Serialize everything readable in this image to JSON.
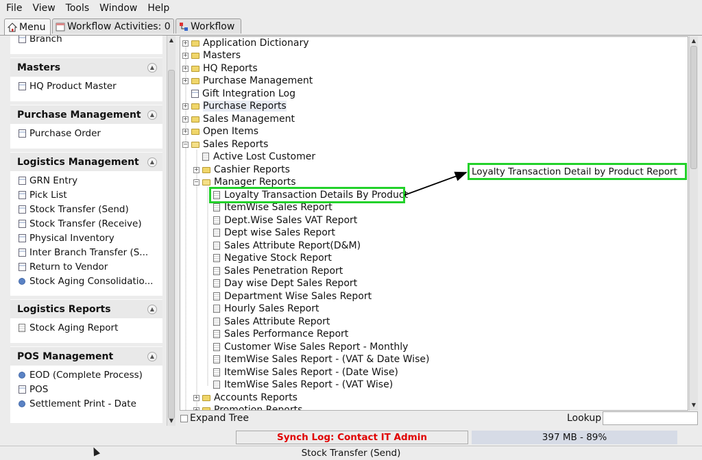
{
  "menubar": {
    "file": "File",
    "view": "View",
    "tools": "Tools",
    "window": "Window",
    "help": "Help"
  },
  "tabs": {
    "menu": "Menu",
    "workflow_activities": "Workflow Activities: 0",
    "workflow": "Workflow"
  },
  "left": {
    "partial_item": "Branch",
    "groups": [
      {
        "title": "Masters",
        "items": [
          "HQ Product Master"
        ]
      },
      {
        "title": "Purchase Management",
        "items": [
          "Purchase Order"
        ]
      },
      {
        "title": "Logistics Management",
        "items": [
          "GRN Entry",
          "Pick List",
          "Stock Transfer (Send)",
          "Stock Transfer (Receive)",
          "Physical Inventory",
          "Inter Branch Transfer (S...",
          "Return to Vendor",
          "Stock Aging Consolidatio..."
        ]
      },
      {
        "title": "Logistics Reports",
        "items": [
          "Stock Aging Report"
        ]
      },
      {
        "title": "POS Management",
        "items": [
          "EOD (Complete Process)",
          "POS",
          "Settlement Print - Date"
        ]
      }
    ]
  },
  "tree": {
    "top": [
      "Application Dictionary",
      "Masters",
      "HQ Reports",
      "Purchase Management",
      "Gift Integration Log",
      "Purchase Reports",
      "Sales Management",
      "Open Items",
      "Sales Reports"
    ],
    "sales_children": [
      "Active Lost Customer",
      "Cashier Reports",
      "Manager Reports"
    ],
    "manager_children": [
      "Loyalty Transaction Details By Product",
      "ItemWise Sales Report",
      "Dept.Wise Sales VAT Report",
      "Dept wise Sales Report",
      "Sales Attribute Report(D&M)",
      "Negative Stock Report",
      "Sales Penetration Report",
      "Day wise Dept Sales Report",
      "Department Wise Sales Report",
      "Hourly Sales Report",
      "Sales Attribute Report",
      "Sales Performance Report",
      "Customer Wise Sales Report - Monthly",
      "ItemWise Sales Report - (VAT & Date Wise)",
      "ItemWise Sales Report - (Date Wise)",
      "ItemWise Sales Report - (VAT Wise)"
    ],
    "after": [
      "Accounts Reports",
      "Promotion Reports"
    ]
  },
  "tree_footer": {
    "expand_tree": "Expand Tree",
    "lookup": "Lookup",
    "lookup_value": ""
  },
  "status": {
    "synch": "Synch Log: Contact IT Admin",
    "memory": "397 MB - 89%",
    "bottom": "Stock Transfer (Send)"
  },
  "callout": {
    "text": "Loyalty Transaction Detail by Product Report"
  },
  "colors": {
    "highlight": "#22d12a",
    "synch_text": "#e00000"
  }
}
